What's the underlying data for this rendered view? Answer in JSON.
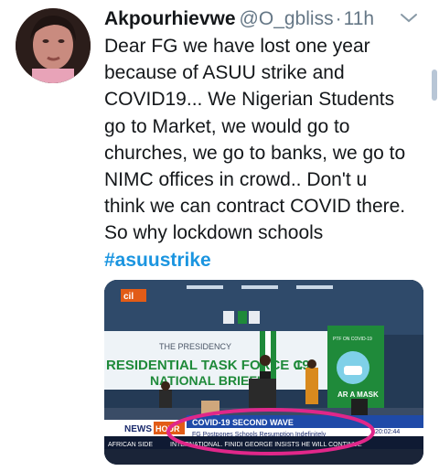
{
  "tweet": {
    "display_name": "Akpourhievwe",
    "handle": "@O_gbliss",
    "separator": "·",
    "time": "11h",
    "lines": [
      "Dear FG we have lost one year",
      "because of ASUU strike and",
      "COVID19... We Nigerian Students",
      "go to Market, we would go to",
      "churches, we go to banks, we go to",
      "NIMC offices in crowd.. Don't u",
      "think we can contract COVID there.",
      "So why lockdown schools"
    ],
    "hashtag": "#asuustrike"
  },
  "media": {
    "channel_logo": "cil",
    "banner_top": "THE PRESIDENCY",
    "banner_line1": "RESIDENTIAL TASK FORCE C",
    "banner_line1_end": "19",
    "banner_line2": "NATIONAL BRIEFIN",
    "side_panel_top": "PTF ON COVID-19",
    "side_panel_text": "AR A MASK",
    "ticker_brand": "NEWS",
    "ticker_brand_suffix": "HOUR",
    "ticker_headline": "COVID-19 SECOND WAVE",
    "ticker_sub": "FG Postpones Schools Resumption Indefinitely",
    "ticker_bottom_left": "AFRICAN SIDE",
    "ticker_bottom": "INTERNATIONAL. FINIDI GEORGE INSISTS HE WILL CONTINUE",
    "ticker_time": "20:02:44"
  },
  "icons": {
    "caret": "chevron-down-icon"
  },
  "colors": {
    "hashtag": "#1b95e0",
    "muted": "#657786",
    "circle": "#e0278a"
  }
}
